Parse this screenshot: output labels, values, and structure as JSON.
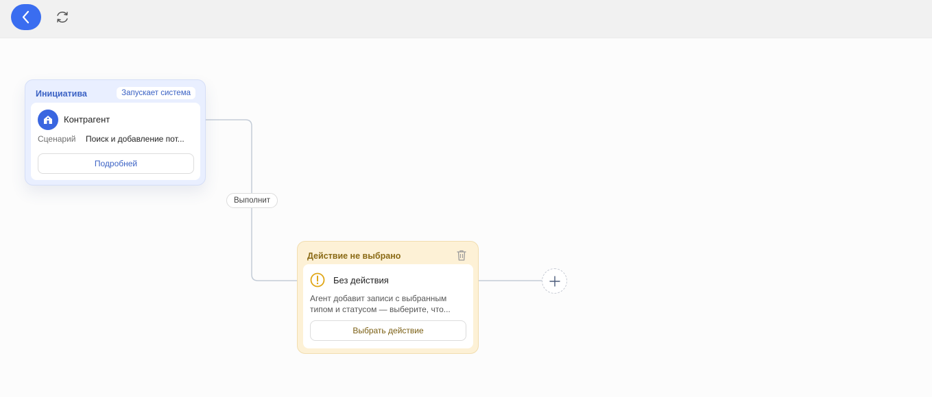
{
  "toolbar": {
    "back_icon": "chevron-left-icon",
    "refresh_icon": "refresh-icon",
    "accent_color": "#3a6df0"
  },
  "initiative_node": {
    "header": "Инициатива",
    "badge": "Запускает система",
    "icon": "building-icon",
    "title": "Контрагент",
    "scenario_label": "Сценарий",
    "scenario_value": "Поиск и добавление пот...",
    "details_button": "Подробней"
  },
  "edge": {
    "label": "Выполнит"
  },
  "action_node": {
    "header": "Действие не выбрано",
    "icon": "warning-icon",
    "delete_icon": "trash-icon",
    "title": "Без действия",
    "description_line1": "Агент добавит записи с выбранным",
    "description_line2": "типом и статусом — выберите, что...",
    "select_button": "Выбрать действие"
  },
  "add_node": {
    "icon": "plus-icon"
  }
}
